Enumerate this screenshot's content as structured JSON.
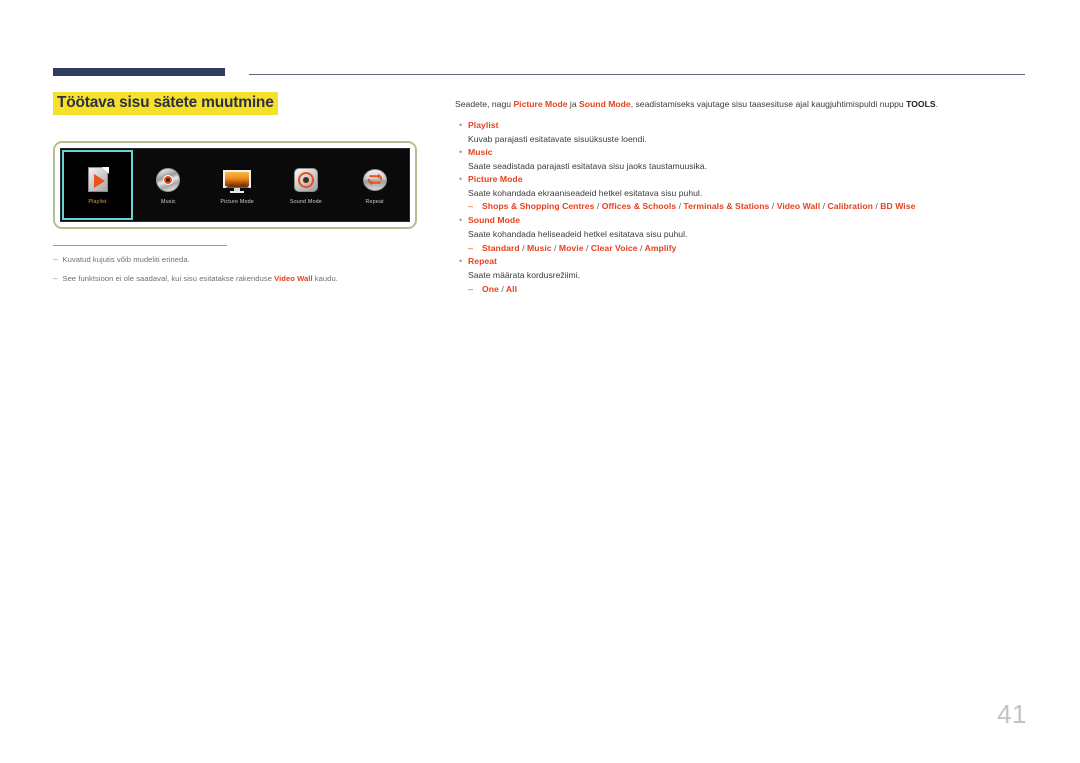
{
  "header": {
    "accent_bar_color": "#303c5c",
    "rule_color": "#5c6580"
  },
  "page": {
    "title": "Töötava sisu sätete muutmine",
    "title_highlight_color": "#f5e12a",
    "number": "41",
    "accent_color": "#e8401e"
  },
  "figure": {
    "border_color": "#b3bf90",
    "background": "#0a0a0a",
    "selected_label_color": "#e0a060",
    "tiles": [
      {
        "label": "Playlist",
        "icon": "playlist-icon",
        "selected": true
      },
      {
        "label": "Music",
        "icon": "music-disc-icon",
        "selected": false
      },
      {
        "label": "Picture Mode",
        "icon": "monitor-icon",
        "selected": false
      },
      {
        "label": "Sound Mode",
        "icon": "speaker-icon",
        "selected": false
      },
      {
        "label": "Repeat",
        "icon": "repeat-loop-icon",
        "selected": false
      }
    ]
  },
  "notes": [
    {
      "dash": "–",
      "text_before": "Kuvatud kujutis võib mudeliti erineda.",
      "bold": "",
      "text_after": ""
    },
    {
      "dash": "–",
      "text_before": "See funktsioon ei ole saadaval, kui sisu esitatakse rakenduse ",
      "bold": "Video Wall",
      "text_after": " kaudu."
    }
  ],
  "content": {
    "intro": {
      "p1": "Seadete, nagu ",
      "a1": "Picture Mode",
      "p2": " ja ",
      "a2": "Sound Mode",
      "p3": ", seadistamiseks vajutage sisu taasesituse ajal kaugjuhtimispuldi nuppu ",
      "s1": "TOOLS",
      "p4": "."
    },
    "bullet_mark": "•",
    "sub_dash": "–",
    "items": [
      {
        "title": "Playlist",
        "desc": "Kuvab parajasti esitatavate sisuüksuste loendi.",
        "options": ""
      },
      {
        "title": "Music",
        "desc": "Saate seadistada parajasti esitatava sisu jaoks taustamuusika.",
        "options": ""
      },
      {
        "title": "Picture Mode",
        "desc": "Saate kohandada ekraaniseadeid hetkel esitatava sisu puhul.",
        "options": "Shops & Shopping Centres / Offices & Schools / Terminals & Stations / Video Wall / Calibration / BD Wise"
      },
      {
        "title": "Sound Mode",
        "desc": "Saate kohandada heliseadeid hetkel esitatava sisu puhul.",
        "options": "Standard / Music / Movie / Clear Voice / Amplify"
      },
      {
        "title": "Repeat",
        "desc": "Saate määrata kordusrežiimi.",
        "options": "One / All"
      }
    ]
  }
}
